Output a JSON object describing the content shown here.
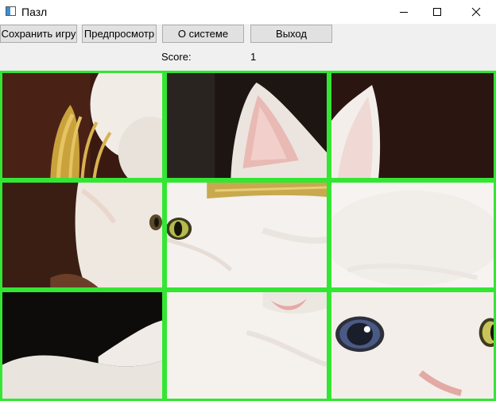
{
  "window": {
    "title": "Пазл",
    "icon": "app-window-icon"
  },
  "toolbar": {
    "save_label": "Сохранить игру",
    "preview_label": "Предпросмотр",
    "about_label": "О системе",
    "exit_label": "Выход"
  },
  "score": {
    "label": "Score:",
    "value": "1"
  },
  "board": {
    "rows": 3,
    "cols": 3,
    "border_color": "#33e633",
    "tiles": [
      {
        "piece": "basket-and-cat-cheek",
        "row": 0,
        "col": 0
      },
      {
        "piece": "cat-ear-left",
        "row": 0,
        "col": 1
      },
      {
        "piece": "cat-ear-right",
        "row": 0,
        "col": 2
      },
      {
        "piece": "cat-cheek-dark-background",
        "row": 1,
        "col": 0
      },
      {
        "piece": "cat-eye-left-with-basket",
        "row": 1,
        "col": 1
      },
      {
        "piece": "white-fur",
        "row": 1,
        "col": 2
      },
      {
        "piece": "cat-chin-dark-background",
        "row": 2,
        "col": 0
      },
      {
        "piece": "cat-nose",
        "row": 2,
        "col": 1
      },
      {
        "piece": "cat-blue-eye-and-yellow-eye",
        "row": 2,
        "col": 2
      }
    ]
  }
}
